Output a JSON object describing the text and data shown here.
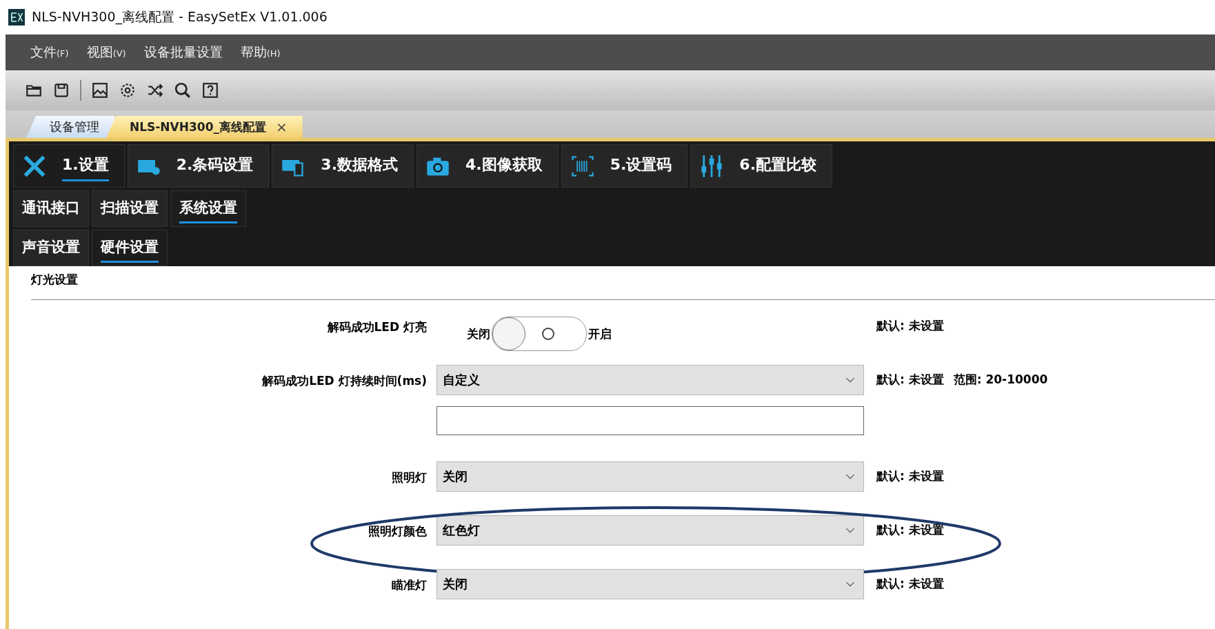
{
  "window": {
    "title": "NLS-NVH300_离线配置 - EasySetEx V1.01.006"
  },
  "menu": [
    {
      "label": "文件",
      "key": "(F)"
    },
    {
      "label": "视图",
      "key": "(V)"
    },
    {
      "label": "设备批量设置"
    },
    {
      "label": "帮助",
      "key": "(H)"
    }
  ],
  "doc_tabs": [
    {
      "label": "设备管理",
      "selected": false
    },
    {
      "label": "NLS-NVH300_离线配置",
      "selected": true,
      "close": "×"
    }
  ],
  "main_tabs": [
    {
      "label": "1.设置",
      "selected": true
    },
    {
      "label": "2.条码设置",
      "selected": false
    },
    {
      "label": "3.数据格式",
      "selected": false
    },
    {
      "label": "4.图像获取",
      "selected": false
    },
    {
      "label": "5.设置码",
      "selected": false
    },
    {
      "label": "6.配置比较",
      "selected": false
    }
  ],
  "sub_tabs": [
    {
      "label": "通讯接口",
      "selected": false
    },
    {
      "label": "扫描设置",
      "selected": false
    },
    {
      "label": "系统设置",
      "selected": true
    }
  ],
  "sub_sub_tabs": [
    {
      "label": "声音设置",
      "selected": false
    },
    {
      "label": "硬件设置",
      "selected": true
    }
  ],
  "section": {
    "title": "灯光设置"
  },
  "settings": [
    {
      "kind": "toggle",
      "label": "解码成功LED 灯亮",
      "off_label": "关闭",
      "on_label": "开启",
      "on": false,
      "default": "默认: 未设置"
    },
    {
      "kind": "dropdown_input",
      "label": "解码成功LED 灯持续时间(ms)",
      "value": "自定义",
      "default": "默认: 未设置",
      "range": "范围: 20-10000"
    },
    {
      "kind": "dropdown",
      "label": "照明灯",
      "value": "关闭",
      "default": "默认: 未设置"
    },
    {
      "kind": "dropdown",
      "label": "照明灯颜色",
      "value": "红色灯",
      "default": "默认: 未设置",
      "highlighted": true
    },
    {
      "kind": "dropdown",
      "label": "瞄准灯",
      "value": "关闭",
      "default": "默认: 未设置"
    }
  ]
}
